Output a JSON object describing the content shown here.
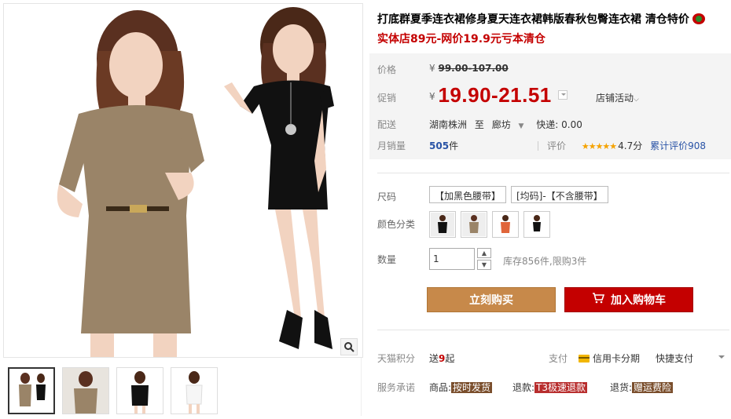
{
  "product": {
    "title": "打底群夏季连衣裙修身夏天连衣裙韩版春秋包臀连衣裙 清仓特价",
    "subtitle": "实体店89元-网价19.9元亏本清仓"
  },
  "price": {
    "label": "价格",
    "currency": "¥",
    "original": "99.00-107.00",
    "promo_label": "促销",
    "promo": "19.90-21.51",
    "store_activity": "店铺活动"
  },
  "shipping": {
    "label": "配送",
    "from": "湖南株洲",
    "to_word": "至",
    "to": "廊坊",
    "fee": "快递: 0.00"
  },
  "sales": {
    "label": "月销量",
    "count": "505",
    "unit": "件",
    "rating_label": "评价",
    "stars": "★★★★★",
    "score": "4.7分",
    "review_count": "累计评价908"
  },
  "sku": {
    "size_label": "尺码",
    "sizes": [
      "【加黑色腰带】",
      "[均码]-【不含腰带】"
    ],
    "color_label": "颜色分类",
    "colors": [
      "black",
      "khaki",
      "orange",
      "black2"
    ],
    "qty_label": "数量",
    "qty_value": "1",
    "stock": "库存856件,限购3件"
  },
  "actions": {
    "buy_now": "立刻购买",
    "add_to_cart": "加入购物车"
  },
  "points": {
    "label": "天猫积分",
    "value_prefix": "送",
    "value_num": "9",
    "value_suffix": "起",
    "pay_label": "支付",
    "credit_installment": "信用卡分期",
    "quick_pay": "快捷支付"
  },
  "service": {
    "label": "服务承诺",
    "goods_label": "商品:",
    "goods_tag": "按时发货",
    "refund_label": "退款:",
    "refund_tag": "T3极速退款",
    "return_label": "退货:",
    "return_tag": "赠运费险"
  },
  "colors": {
    "brand_red": "#c40000",
    "buy_button": "#c7894a",
    "link_blue": "#2953a6"
  }
}
